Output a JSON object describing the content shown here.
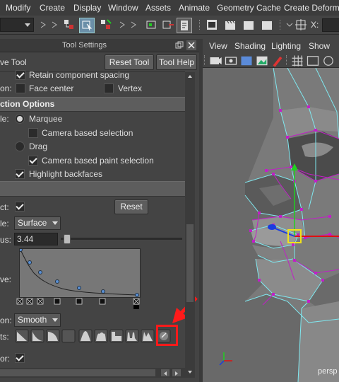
{
  "menubar": [
    "Modify",
    "Create",
    "Display",
    "Window",
    "Assets",
    "Animate",
    "Geometry Cache",
    "Create Deformers"
  ],
  "shelf": {
    "coord_label": "X:"
  },
  "tool_settings": {
    "title": "Tool Settings",
    "tool_name": "ve Tool",
    "reset_tool": "Reset Tool",
    "tool_help": "Tool Help",
    "retain_label": "Retain component spacing",
    "face_row": {
      "label": "on:",
      "face_center": "Face center",
      "vertex": "Vertex"
    },
    "section_title": "ction Options",
    "marquee_row_label": "le:",
    "marquee": "Marquee",
    "camera_based_selection": "Camera based selection",
    "drag": "Drag",
    "camera_based_paint": "Camera based paint selection",
    "highlight_backfaces": "Highlight backfaces",
    "soft_row_label": "ct:",
    "reset": "Reset",
    "falloff_mode_label": "le:",
    "falloff_mode": "Surface",
    "radius_label": "us:",
    "radius_value": "3.44",
    "curve_label": "ve:",
    "interp_label": "on:",
    "interpolation": "Smooth",
    "presets_label": "ts:",
    "color_label": "or:"
  },
  "viewport": {
    "menu": [
      "View",
      "Shading",
      "Lighting",
      "Show"
    ],
    "camera": "persp"
  },
  "colors": {
    "annotation_red": "#ff1a1a",
    "wire_cyan": "#7fe8f0",
    "vertex_magenta": "#c21ec8"
  }
}
